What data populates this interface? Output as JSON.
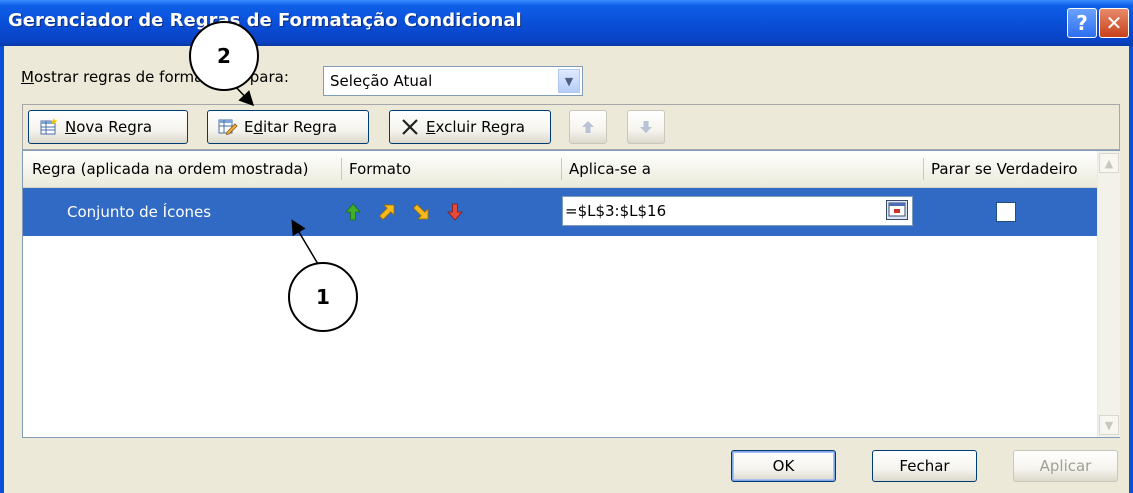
{
  "window": {
    "title": "Gerenciador de Regras de Formatação Condicional",
    "help_glyph": "?",
    "close_glyph": "✕"
  },
  "show_rules": {
    "label_underlined": "M",
    "label_rest": "ostrar regras de formatação para:",
    "selected": "Seleção Atual"
  },
  "toolbar": {
    "new_rule": {
      "u": "N",
      "rest": "ova Regra"
    },
    "edit_rule": {
      "pre": "E",
      "u": "d",
      "rest": "itar Regra"
    },
    "delete_rule": {
      "pre": "",
      "u": "E",
      "rest": "xcluir Regra"
    }
  },
  "table": {
    "headers": [
      "Regra (aplicada na ordem mostrada)",
      "Formato",
      "Aplica-se a",
      "Parar se Verdadeiro"
    ],
    "rows": [
      {
        "rule": "Conjunto de Ícones",
        "applies_to": "=$L$3:$L$16",
        "stop_if_true": false
      }
    ]
  },
  "footer": {
    "ok": "OK",
    "close": "Fechar",
    "apply": "Aplicar"
  },
  "callouts": {
    "one": "1",
    "two": "2"
  },
  "colors": {
    "titlebar": "#0a4fd8",
    "selection": "#316ac5",
    "dialog_bg": "#ece9d8"
  },
  "icons": {
    "format_icons": [
      "arrow-up-green-icon",
      "arrow-up-right-yellow-icon",
      "arrow-down-right-yellow-icon",
      "arrow-down-red-icon"
    ]
  }
}
